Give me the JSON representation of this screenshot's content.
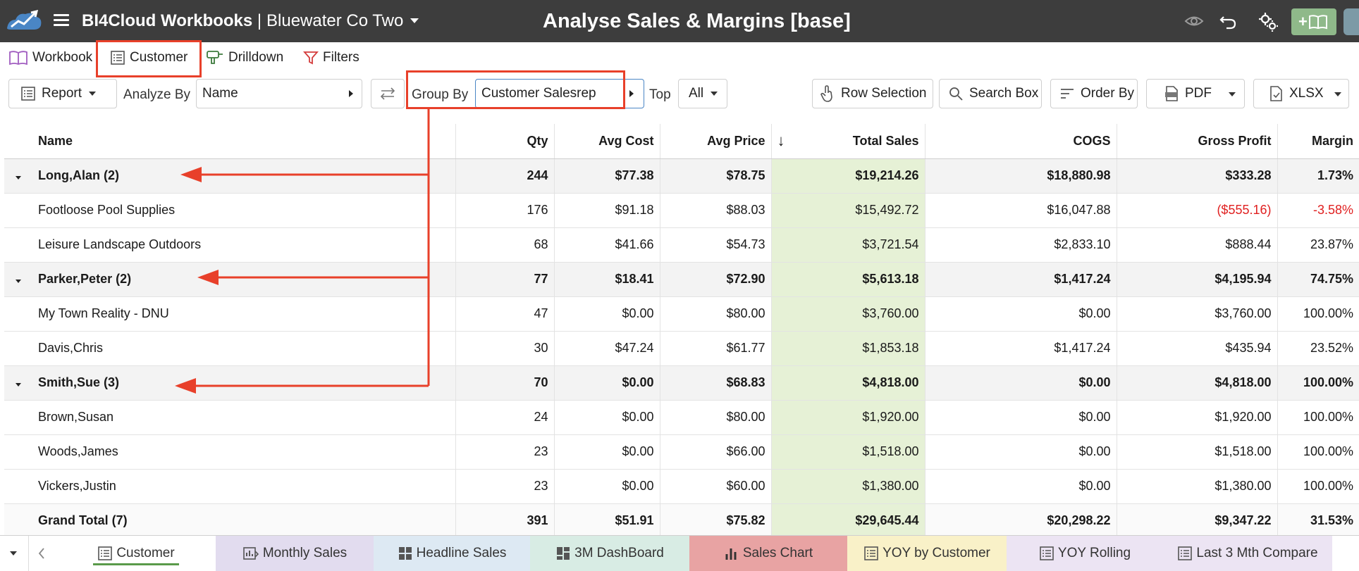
{
  "header": {
    "app_name": "BI4Cloud Workbooks",
    "separator": "|",
    "company": "Bluewater Co Two",
    "page_title": "Analyse Sales & Margins [base]",
    "add_label": "+",
    "background": "#3d3d3d"
  },
  "nav_tabs": [
    {
      "label": "Workbook",
      "icon": "book-icon"
    },
    {
      "label": "Customer",
      "icon": "list-icon"
    },
    {
      "label": "Drilldown",
      "icon": "drill-icon"
    },
    {
      "label": "Filters",
      "icon": "filter-icon"
    }
  ],
  "toolbar": {
    "report_label": "Report",
    "analyze_by_label": "Analyze By",
    "analyze_by_value": "Name",
    "group_by_label": "Group By",
    "group_by_value": "Customer Salesrep",
    "top_label": "Top",
    "top_value": "All",
    "row_selection": "Row Selection",
    "search_box": "Search Box",
    "order_by": "Order By",
    "pdf": "PDF",
    "xlsx": "XLSX"
  },
  "table": {
    "headers": {
      "name": "Name",
      "qty": "Qty",
      "avg_cost": "Avg Cost",
      "avg_price": "Avg Price",
      "sort_indicator": "↓",
      "total_sales": "Total Sales",
      "cogs": "COGS",
      "gross_profit": "Gross Profit",
      "margin": "Margin"
    },
    "rows": [
      {
        "type": "group",
        "name": "Long,Alan (2)",
        "qty": "244",
        "avg_cost": "$77.38",
        "avg_price": "$78.75",
        "total_sales": "$19,214.26",
        "cogs": "$18,880.98",
        "gross_profit": "$333.28",
        "margin": "1.73%"
      },
      {
        "type": "detail",
        "name": "Footloose Pool Supplies",
        "qty": "176",
        "avg_cost": "$91.18",
        "avg_price": "$88.03",
        "total_sales": "$15,492.72",
        "cogs": "$16,047.88",
        "gross_profit": "($555.16)",
        "margin": "-3.58%",
        "negative": true
      },
      {
        "type": "detail",
        "name": "Leisure Landscape Outdoors",
        "qty": "68",
        "avg_cost": "$41.66",
        "avg_price": "$54.73",
        "total_sales": "$3,721.54",
        "cogs": "$2,833.10",
        "gross_profit": "$888.44",
        "margin": "23.87%"
      },
      {
        "type": "group",
        "name": "Parker,Peter (2)",
        "qty": "77",
        "avg_cost": "$18.41",
        "avg_price": "$72.90",
        "total_sales": "$5,613.18",
        "cogs": "$1,417.24",
        "gross_profit": "$4,195.94",
        "margin": "74.75%"
      },
      {
        "type": "detail",
        "name": "My Town Reality - DNU",
        "qty": "47",
        "avg_cost": "$0.00",
        "avg_price": "$80.00",
        "total_sales": "$3,760.00",
        "cogs": "$0.00",
        "gross_profit": "$3,760.00",
        "margin": "100.00%"
      },
      {
        "type": "detail",
        "name": "Davis,Chris",
        "qty": "30",
        "avg_cost": "$47.24",
        "avg_price": "$61.77",
        "total_sales": "$1,853.18",
        "cogs": "$1,417.24",
        "gross_profit": "$435.94",
        "margin": "23.52%"
      },
      {
        "type": "group",
        "name": "Smith,Sue (3)",
        "qty": "70",
        "avg_cost": "$0.00",
        "avg_price": "$68.83",
        "total_sales": "$4,818.00",
        "cogs": "$0.00",
        "gross_profit": "$4,818.00",
        "margin": "100.00%"
      },
      {
        "type": "detail",
        "name": "Brown,Susan",
        "qty": "24",
        "avg_cost": "$0.00",
        "avg_price": "$80.00",
        "total_sales": "$1,920.00",
        "cogs": "$0.00",
        "gross_profit": "$1,920.00",
        "margin": "100.00%"
      },
      {
        "type": "detail",
        "name": "Woods,James",
        "qty": "23",
        "avg_cost": "$0.00",
        "avg_price": "$66.00",
        "total_sales": "$1,518.00",
        "cogs": "$0.00",
        "gross_profit": "$1,518.00",
        "margin": "100.00%"
      },
      {
        "type": "detail",
        "name": "Vickers,Justin",
        "qty": "23",
        "avg_cost": "$0.00",
        "avg_price": "$60.00",
        "total_sales": "$1,380.00",
        "cogs": "$0.00",
        "gross_profit": "$1,380.00",
        "margin": "100.00%"
      },
      {
        "type": "total",
        "name": "Grand Total (7)",
        "qty": "391",
        "avg_cost": "$51.91",
        "avg_price": "$75.82",
        "total_sales": "$29,645.44",
        "cogs": "$20,298.22",
        "gross_profit": "$9,347.22",
        "margin": "31.53%"
      }
    ]
  },
  "sheet_tabs": [
    {
      "label": "Customer",
      "icon": "list-icon",
      "color": "#ffffff",
      "active": true
    },
    {
      "label": "Monthly Sales",
      "icon": "calendar-chart-icon",
      "color": "#e2dcef"
    },
    {
      "label": "Headline Sales",
      "icon": "grid-icon",
      "color": "#dde9f3"
    },
    {
      "label": "3M DashBoard",
      "icon": "dashboard-icon",
      "color": "#d8ece4"
    },
    {
      "label": "Sales Chart",
      "icon": "bar-chart-icon",
      "color": "#e8a3a3"
    },
    {
      "label": "YOY by Customer",
      "icon": "list-icon",
      "color": "#f9f1c8"
    },
    {
      "label": "YOY Rolling",
      "icon": "list-icon",
      "color": "#ece4f3"
    },
    {
      "label": "Last 3 Mth Compare",
      "icon": "list-icon",
      "color": "#ece4f3"
    }
  ],
  "colors": {
    "highlight": "#e8402a",
    "sales_column": "#e6f1d6",
    "negative": "#e02020",
    "active_tab_underline": "#5a9a4a"
  }
}
